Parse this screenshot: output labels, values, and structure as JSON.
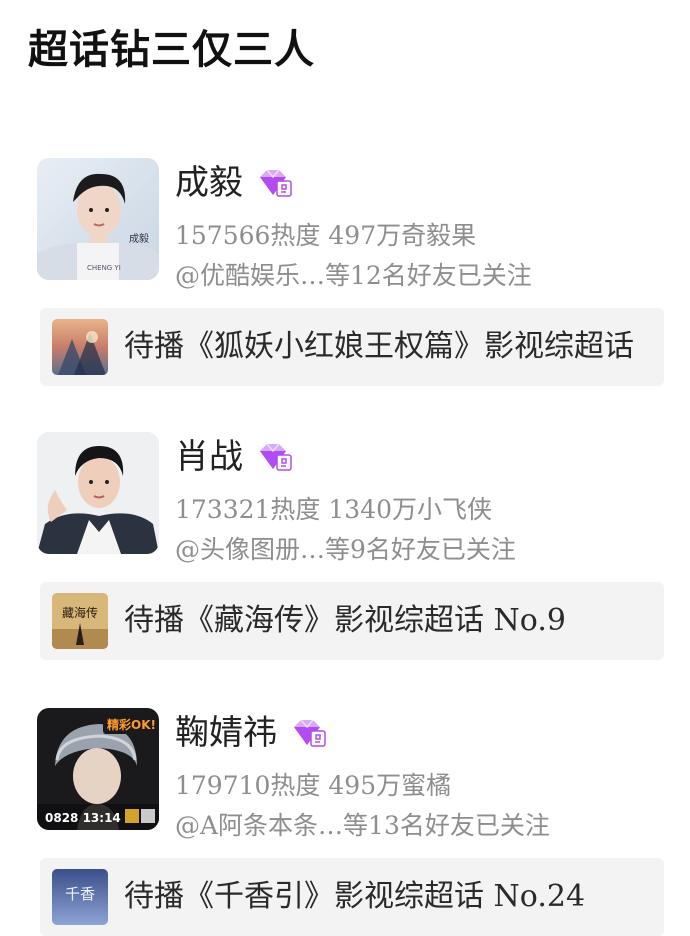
{
  "header": {
    "title": "超话钻三仅三人"
  },
  "entries": [
    {
      "name": "成毅",
      "stats": "157566热度 497万奇毅果",
      "friends": "@优酷娱乐…等12名好友已关注",
      "banner": "待播《狐妖小红娘王权篇》影视综超话",
      "avatar_text": "成毅",
      "avatar_subtext": "CHENG YI",
      "badge_icon": "diamond-vip-icon"
    },
    {
      "name": "肖战",
      "stats": "173321热度 1340万小飞侠",
      "friends": "@头像图册…等9名好友已关注",
      "banner": "待播《藏海传》影视综超话 No.9",
      "badge_icon": "diamond-vip-icon",
      "banner_thumb_text": "藏海传"
    },
    {
      "name": "鞠婧祎",
      "stats": "179710热度 495万蜜橘",
      "friends": "@A阿条本条…等13名好友已关注",
      "banner": "待播《千香引》影视综超话 No.24",
      "badge_icon": "diamond-vip-icon",
      "avatar_top_text": "精彩OK!",
      "avatar_bottom_text": "0828 13:14",
      "banner_thumb_text": "千香"
    }
  ],
  "colors": {
    "badge": "#b24bf0",
    "banner_bg": "#f3f3f3",
    "meta_text": "#8e8e8e"
  }
}
